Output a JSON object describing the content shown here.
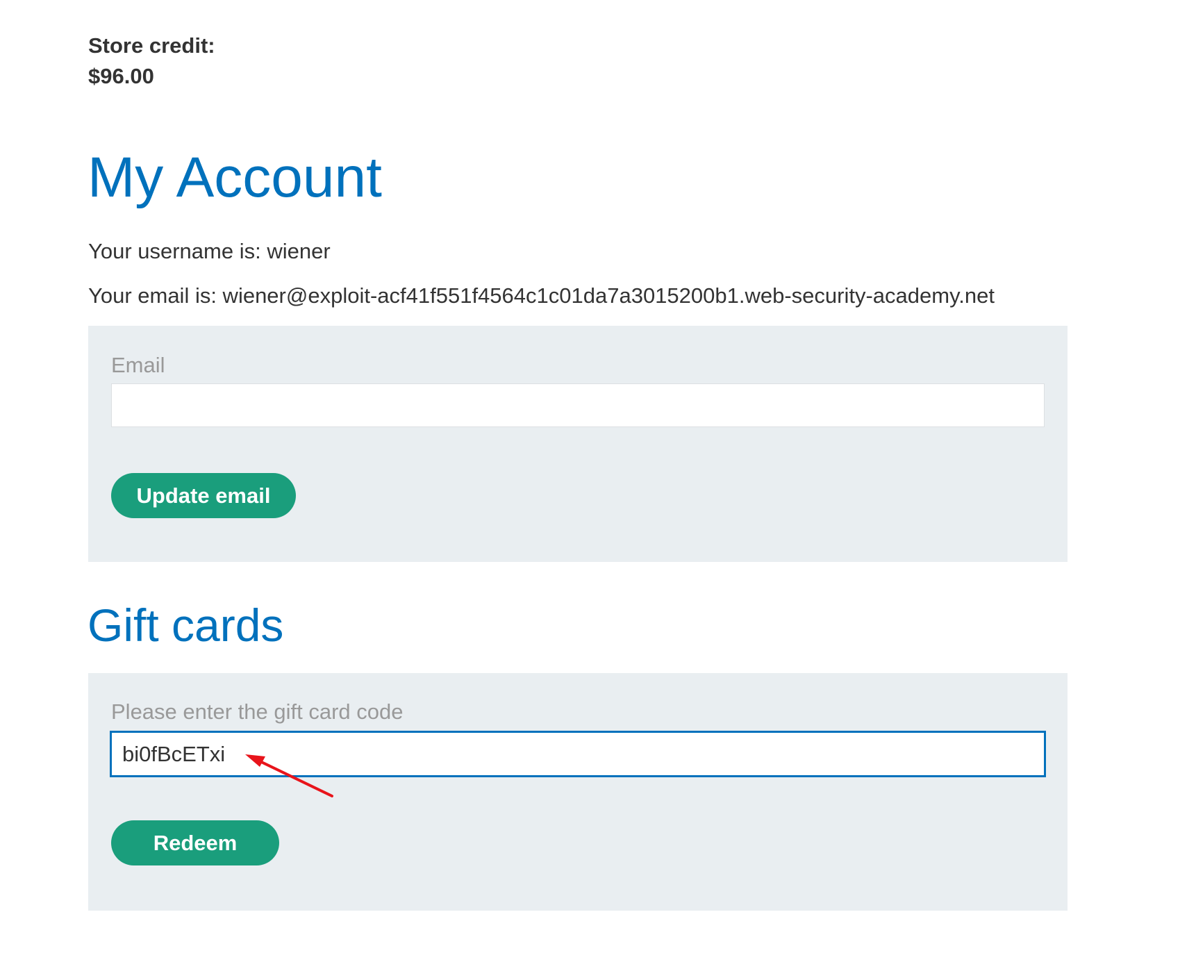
{
  "store_credit": {
    "label": "Store credit:",
    "amount": "$96.00"
  },
  "account": {
    "title": "My Account",
    "username_line": "Your username is: wiener",
    "email_line": "Your email is: wiener@exploit-acf41f551f4564c1c01da7a3015200b1.web-security-academy.net"
  },
  "email_form": {
    "label": "Email",
    "value": "",
    "button_label": "Update email"
  },
  "gift_cards": {
    "title": "Gift cards",
    "label": "Please enter the gift card code",
    "value": "bi0fBcETxi",
    "button_label": "Redeem"
  },
  "colors": {
    "heading": "#0071bc",
    "button": "#1a9e7c",
    "panel": "#e9eef1",
    "annotation": "#e8141b"
  }
}
